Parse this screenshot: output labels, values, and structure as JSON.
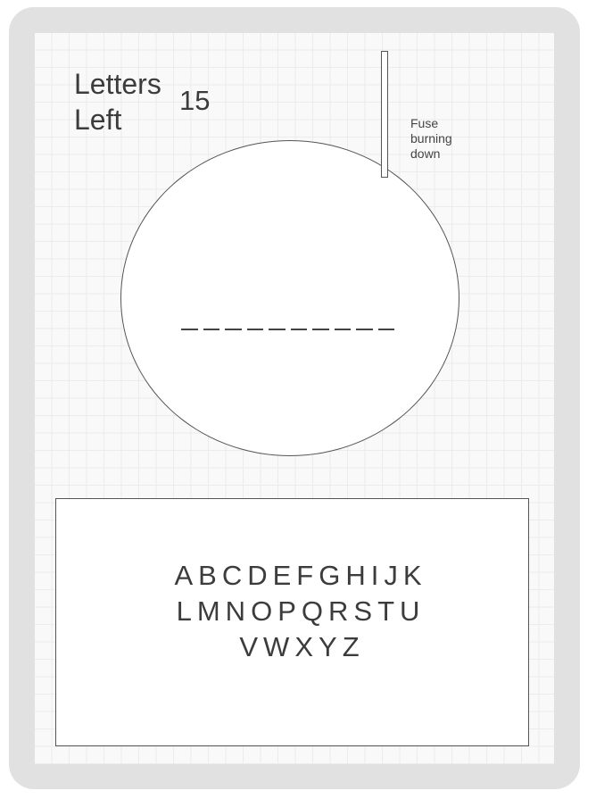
{
  "status": {
    "letters_left_label": "Letters Left",
    "letters_left_value": "15"
  },
  "fuse": {
    "note": "Fuse burning down"
  },
  "word": {
    "blank_count": 10
  },
  "keyboard": {
    "rows": [
      [
        "A",
        "B",
        "C",
        "D",
        "E",
        "F",
        "G",
        "H",
        "I",
        "J",
        "K"
      ],
      [
        "L",
        "M",
        "N",
        "O",
        "P",
        "Q",
        "R",
        "S",
        "T",
        "U"
      ],
      [
        "V",
        "W",
        "X",
        "Y",
        "Z"
      ]
    ]
  }
}
